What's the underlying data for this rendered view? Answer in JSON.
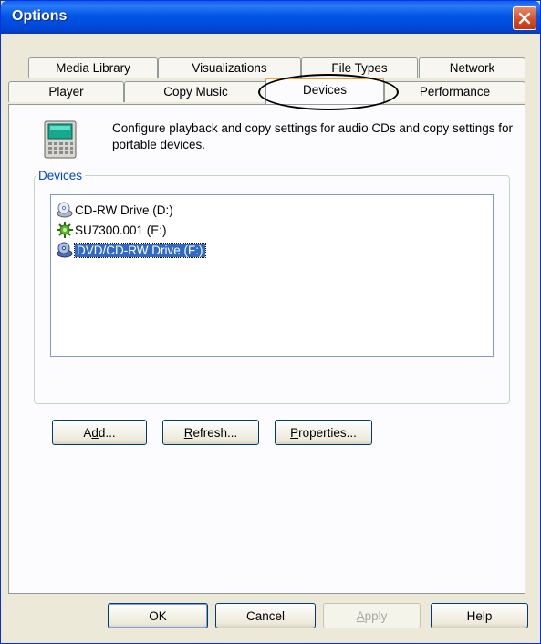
{
  "window": {
    "title": "Options"
  },
  "tabs": {
    "row1": [
      {
        "label": "Media Library"
      },
      {
        "label": "Visualizations"
      },
      {
        "label": "File Types"
      },
      {
        "label": "Network"
      }
    ],
    "row2": [
      {
        "label": "Player"
      },
      {
        "label": "Copy Music"
      },
      {
        "label": "Devices",
        "active": true
      },
      {
        "label": "Performance"
      }
    ]
  },
  "panel": {
    "description": "Configure playback and copy settings for audio CDs and copy settings for portable devices.",
    "group_label": "Devices",
    "devices": [
      {
        "label": "CD-RW Drive (D:)",
        "icon": "cd-drive-icon",
        "selected": false
      },
      {
        "label": "SU7300.001 (E:)",
        "icon": "portable-device-icon",
        "selected": false
      },
      {
        "label": "DVD/CD-RW Drive (F:)",
        "icon": "dvd-drive-icon",
        "selected": true
      }
    ],
    "buttons": {
      "add": {
        "pre": "A",
        "key": "d",
        "post": "d..."
      },
      "refresh": {
        "pre": "",
        "key": "R",
        "post": "efresh..."
      },
      "properties": {
        "pre": "",
        "key": "P",
        "post": "roperties..."
      }
    }
  },
  "footer": {
    "ok": "OK",
    "cancel": "Cancel",
    "apply": {
      "pre": "",
      "key": "A",
      "post": "pply"
    },
    "help": "Help"
  },
  "colors": {
    "titlebar": "#0055e5",
    "selection": "#316ac5",
    "group_label": "#0046d5"
  }
}
